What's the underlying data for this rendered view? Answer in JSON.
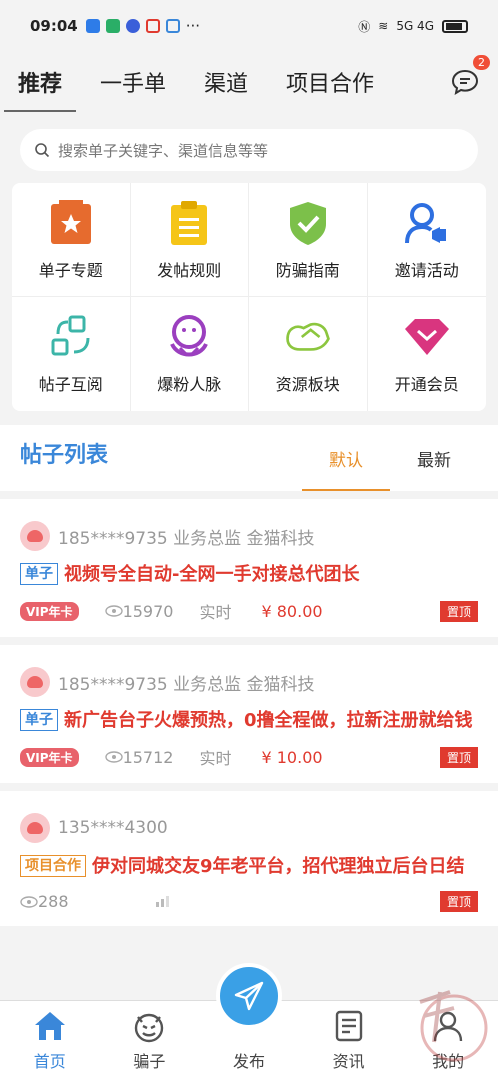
{
  "status": {
    "time": "09:04",
    "network": "5G 4G"
  },
  "top_tabs": [
    "推荐",
    "一手单",
    "渠道",
    "项目合作"
  ],
  "message_badge": "2",
  "search": {
    "placeholder": "搜索单子关键字、渠道信息等等"
  },
  "grid": [
    {
      "label": "单子专题",
      "icon": "star-folder-icon"
    },
    {
      "label": "发帖规则",
      "icon": "clipboard-icon"
    },
    {
      "label": "防骗指南",
      "icon": "shield-check-icon"
    },
    {
      "label": "邀请活动",
      "icon": "user-megaphone-icon"
    },
    {
      "label": "帖子互阅",
      "icon": "exchange-icon"
    },
    {
      "label": "爆粉人脉",
      "icon": "hugging-person-icon"
    },
    {
      "label": "资源板块",
      "icon": "handshake-icon"
    },
    {
      "label": "开通会员",
      "icon": "diamond-icon"
    }
  ],
  "list": {
    "title": "帖子列表",
    "sort_default": "默认",
    "sort_latest": "最新"
  },
  "posts": [
    {
      "user": "185****9735 业务总监 金猫科技",
      "tag": "单子",
      "title": "视频号全自动-全网一手对接总代团长",
      "vip": "VIP年卡",
      "views": "15970",
      "time": "实时",
      "price": "¥ 80.00",
      "badge": "置顶"
    },
    {
      "user": "185****9735 业务总监 金猫科技",
      "tag": "单子",
      "title": "新广告台子火爆预热，0撸全程做，拉新注册就给钱",
      "vip": "VIP年卡",
      "views": "15712",
      "time": "实时",
      "price": "¥ 10.00",
      "badge": "置顶"
    },
    {
      "user": "135****4300",
      "tag": "项目合作",
      "title": "伊对同城交友9年老平台，招代理独立后台日结",
      "views": "288",
      "badge": "置顶"
    }
  ],
  "bottom_nav": [
    "首页",
    "骗子",
    "发布",
    "资讯",
    "我的"
  ],
  "colors": {
    "accent": "#3a87d9",
    "red": "#e03a2f",
    "orange": "#e8902b"
  }
}
